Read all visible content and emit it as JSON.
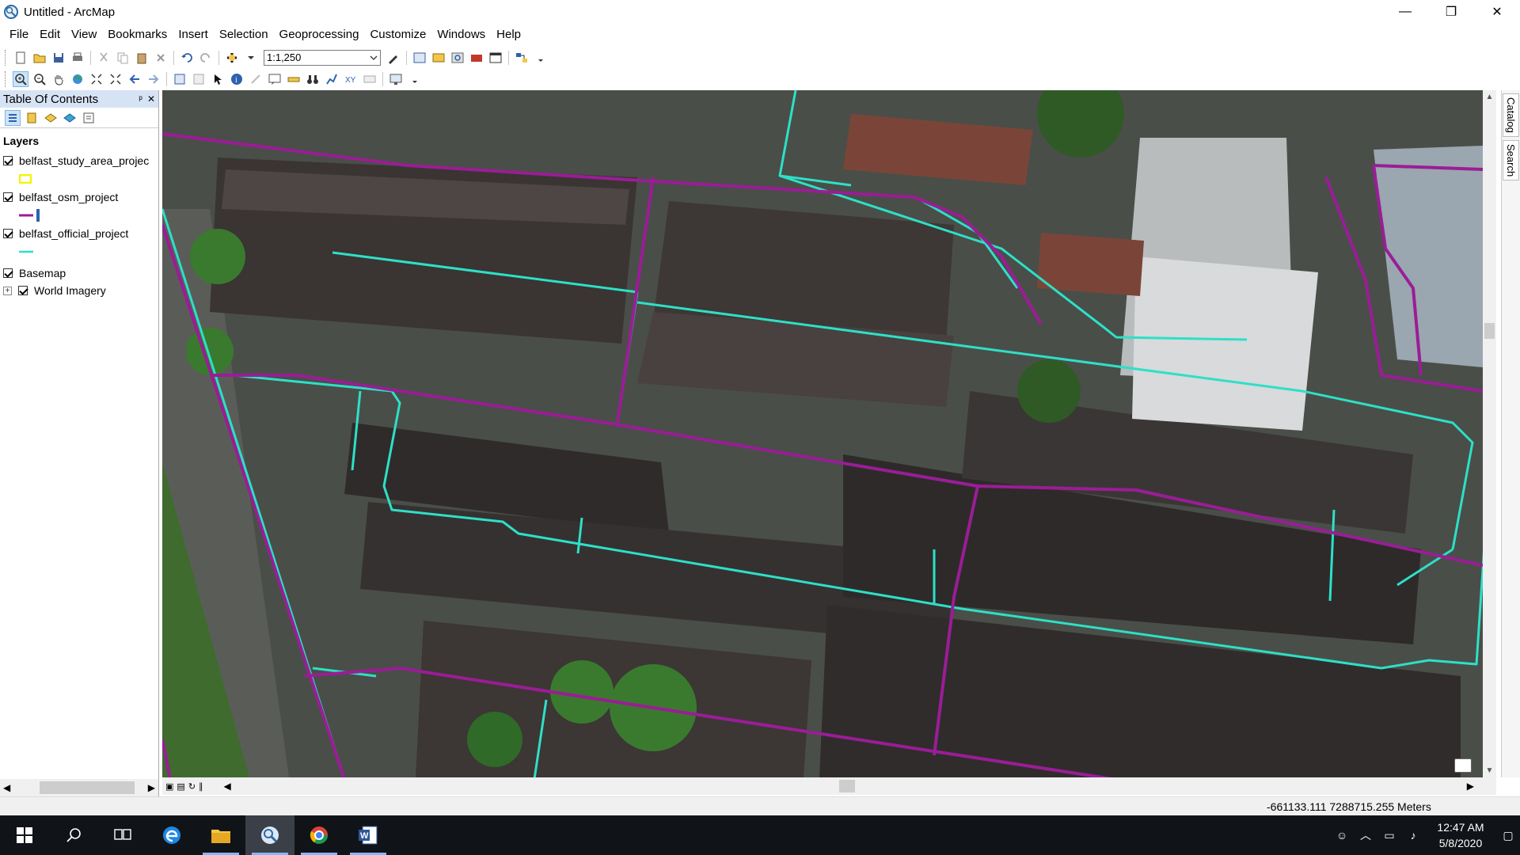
{
  "window": {
    "title": "Untitled - ArcMap",
    "minimize_label": "—",
    "restore_label": "❐",
    "close_label": "✕"
  },
  "menu": [
    "File",
    "Edit",
    "View",
    "Bookmarks",
    "Insert",
    "Selection",
    "Geoprocessing",
    "Customize",
    "Windows",
    "Help"
  ],
  "toolbar": {
    "scale": "1:1,250"
  },
  "toc": {
    "title": "Table Of Contents",
    "pin_label": "ᵖ",
    "close_label": "✕",
    "root": "Layers",
    "layers": [
      {
        "name": "belfast_study_area_projec",
        "legend": "yellow-box",
        "color": "#f4f400"
      },
      {
        "name": "belfast_osm_project",
        "legend": "line",
        "color": "#9a1d96"
      },
      {
        "name": "belfast_official_project",
        "legend": "line",
        "color": "#2de0c8"
      }
    ],
    "basemap_group": "Basemap",
    "basemap_layer": "World Imagery"
  },
  "dock": {
    "catalog": "Catalog",
    "search": "Search"
  },
  "status": {
    "coords": "-661133.111  7288715.255 Meters"
  },
  "taskbar": {
    "time": "12:47 AM",
    "date": "5/8/2020"
  },
  "colors": {
    "osm_line": "#9a1d96",
    "official_line": "#2de0c8",
    "toc_header": "#d6e3f5",
    "taskbar": "#101418"
  }
}
